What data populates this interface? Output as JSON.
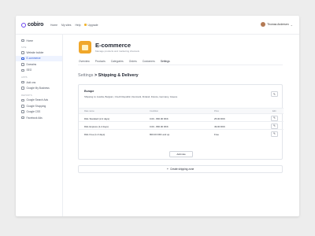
{
  "brand": {
    "name": "cobiro",
    "accent": "#6a46f0"
  },
  "topnav": {
    "items": [
      "Home",
      "My sites",
      "Help"
    ],
    "upgrade": "Upgrade"
  },
  "user": {
    "name": "Thomas Andersen"
  },
  "sidebar": {
    "top": [
      {
        "label": "Home",
        "icon": "home-icon"
      }
    ],
    "sections": [
      {
        "title": "SITE",
        "items": [
          {
            "label": "Website builder",
            "icon": "website-icon"
          },
          {
            "label": "E-commerce",
            "icon": "cart-icon",
            "active": true
          },
          {
            "label": "Domains",
            "icon": "globe-icon"
          },
          {
            "label": "SEO",
            "icon": "seo-icon"
          }
        ]
      },
      {
        "title": "APPS",
        "items": [
          {
            "label": "Add ons",
            "icon": "plus-icon"
          },
          {
            "label": "Google My Business",
            "icon": "store-icon"
          }
        ]
      },
      {
        "title": "REPORTS",
        "items": [
          {
            "label": "Google Search Ads",
            "icon": "search-icon"
          },
          {
            "label": "Google Shopping",
            "icon": "tag-icon"
          },
          {
            "label": "Google CSS",
            "icon": "chart-icon"
          },
          {
            "label": "Facebook Ads",
            "icon": "facebook-icon"
          }
        ]
      }
    ]
  },
  "header": {
    "title": "E-commerce",
    "subtitle": "Manage products and marketing channels"
  },
  "tabs": [
    "Overview",
    "Products",
    "Categories",
    "Orders",
    "Customers",
    "Settings"
  ],
  "active_tab": "Settings",
  "breadcrumb": {
    "parent": "Settings",
    "sep": ">",
    "current": "Shipping & Delivery"
  },
  "zone": {
    "title": "Europe",
    "shipping_to": "Shipping to: Austria, Belgium, Czech Republic, Denmark, Finland, France, Germany, Greece",
    "columns": [
      "Rate name",
      "Condition",
      "Price",
      "Edit"
    ],
    "rows": [
      {
        "name": "DHL Standard (2-4 days)",
        "condition": "0.00 - 800.00 DKK",
        "price": "25.00 DKK"
      },
      {
        "name": "DHL Express (1-2 days)",
        "condition": "0.00 - 800.00 DKK",
        "price": "49.00 DKK"
      },
      {
        "name": "DHL Free (1-3 days)",
        "condition": "800.00 DKK and up",
        "price": "Free"
      }
    ],
    "add_rate": "Add rate"
  },
  "create_zone": "Create shipping zone"
}
